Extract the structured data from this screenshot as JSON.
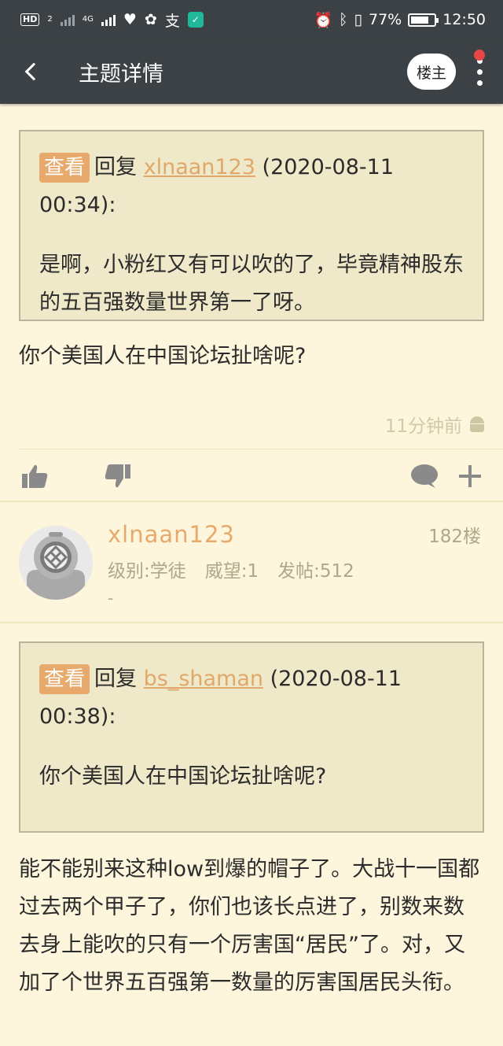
{
  "status_bar": {
    "hd_label": "HD",
    "sim_index": "2",
    "network_label": "4G",
    "battery_percent": "77%",
    "battery_level": 0.77,
    "time": "12:50"
  },
  "app_bar": {
    "title": "主题详情",
    "owner_button": "楼主"
  },
  "post1": {
    "quote_tag": "查看",
    "quote_prefix": "回复",
    "quote_user": "xlnaan123",
    "quote_time": "(2020-08-11 00:34):",
    "quote_body": "是啊，小粉红又有可以吹的了，毕竟精神股东的五百强数量世界第一了呀。",
    "body": "你个美国人在中国论坛扯啥呢?",
    "time_ago": "11分钟前"
  },
  "post2": {
    "username": "xlnaan123",
    "floor": "182楼",
    "level_label": "级别:学徒",
    "prestige_label": "威望:1",
    "posts_label": "发帖:512",
    "signature": "-",
    "quote_tag": "查看",
    "quote_prefix": "回复",
    "quote_user": "bs_shaman",
    "quote_time": "(2020-08-11 00:38):",
    "quote_body": "你个美国人在中国论坛扯啥呢?",
    "body": "能不能别来这种low到爆的帽子了。大战十一国都过去两个甲子了，你们也该长点进了，别数来数去身上能吹的只有一个厉害国“居民”了。对，又加了个世界五百强第一数量的厉害国居民头衔。"
  },
  "colors": {
    "app_bar": "#3b4144",
    "page_bg": "#fdf6dc",
    "quote_bg": "#efe8c9",
    "accent": "#e8a96d",
    "icon_gray": "#8a8a8a",
    "notification_dot": "#e84545"
  },
  "icons": [
    "back-icon",
    "more-icon",
    "thumbs-up-icon",
    "thumbs-down-icon",
    "comment-icon",
    "add-icon",
    "android-icon"
  ]
}
